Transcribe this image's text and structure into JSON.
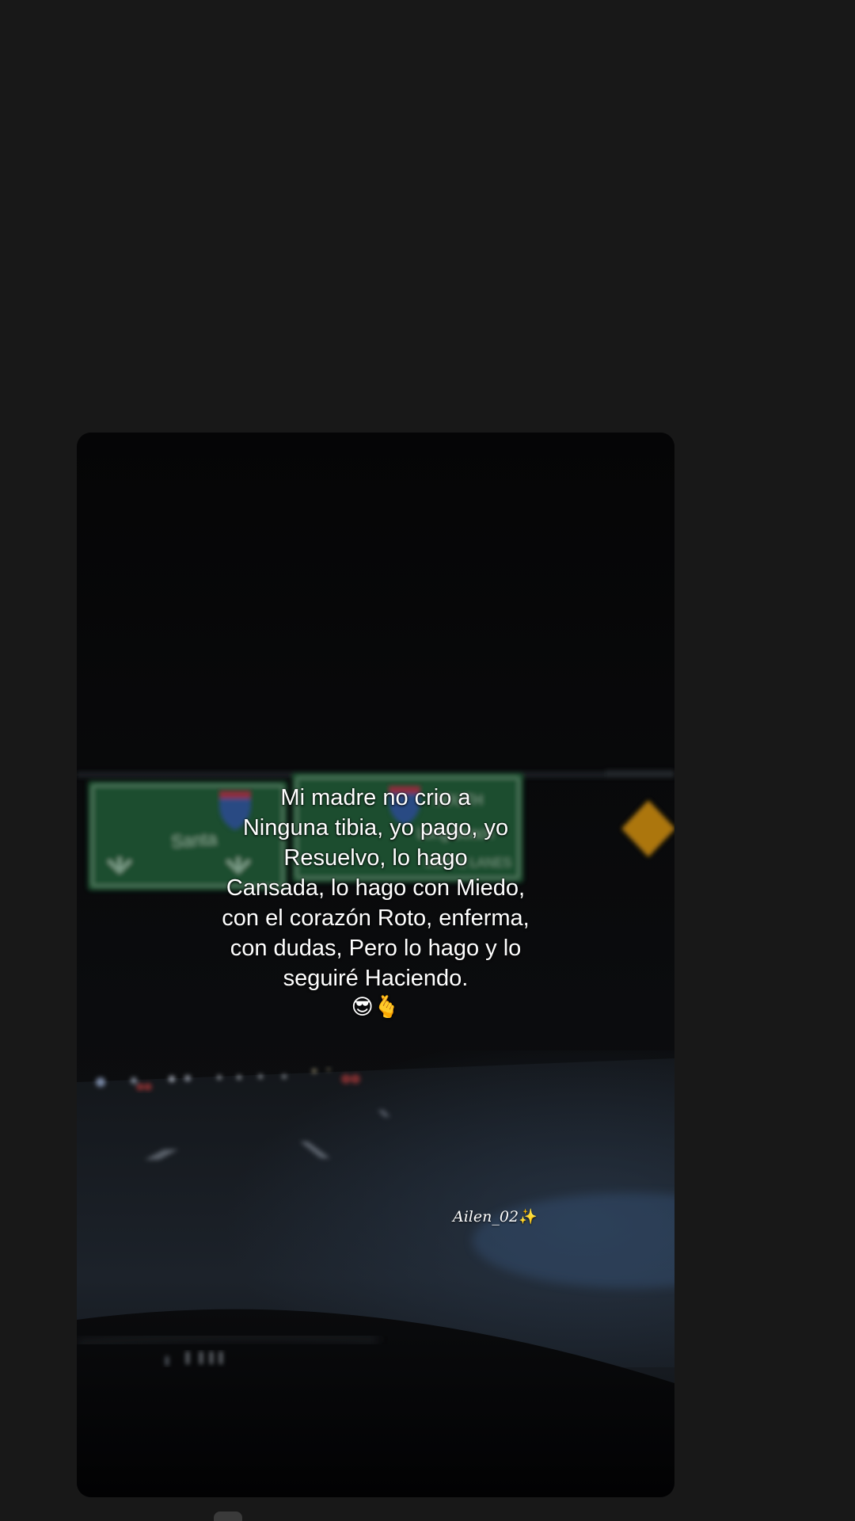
{
  "post": {
    "caption_lines": [
      "Mi madre no crio a",
      "Ninguna tibia, yo pago, yo",
      "Resuelvo, lo hago",
      "Cansada, lo hago con Miedo,",
      "con el corazón Roto, enferma,",
      "con dudas, Pero lo hago y lo",
      "seguiré Haciendo."
    ],
    "caption_emoji": "😎🫰",
    "watermark_text": "Ailen_02",
    "watermark_emoji": "✨"
  },
  "colors": {
    "page_background": "#181818",
    "media_background": "#070708",
    "sign_green": "#1f5a35",
    "warning_sign": "#c98a12"
  },
  "icons": {
    "highway_shield": "interstate-shield-icon",
    "warning_sign": "diamond-warning-sign-icon"
  }
}
